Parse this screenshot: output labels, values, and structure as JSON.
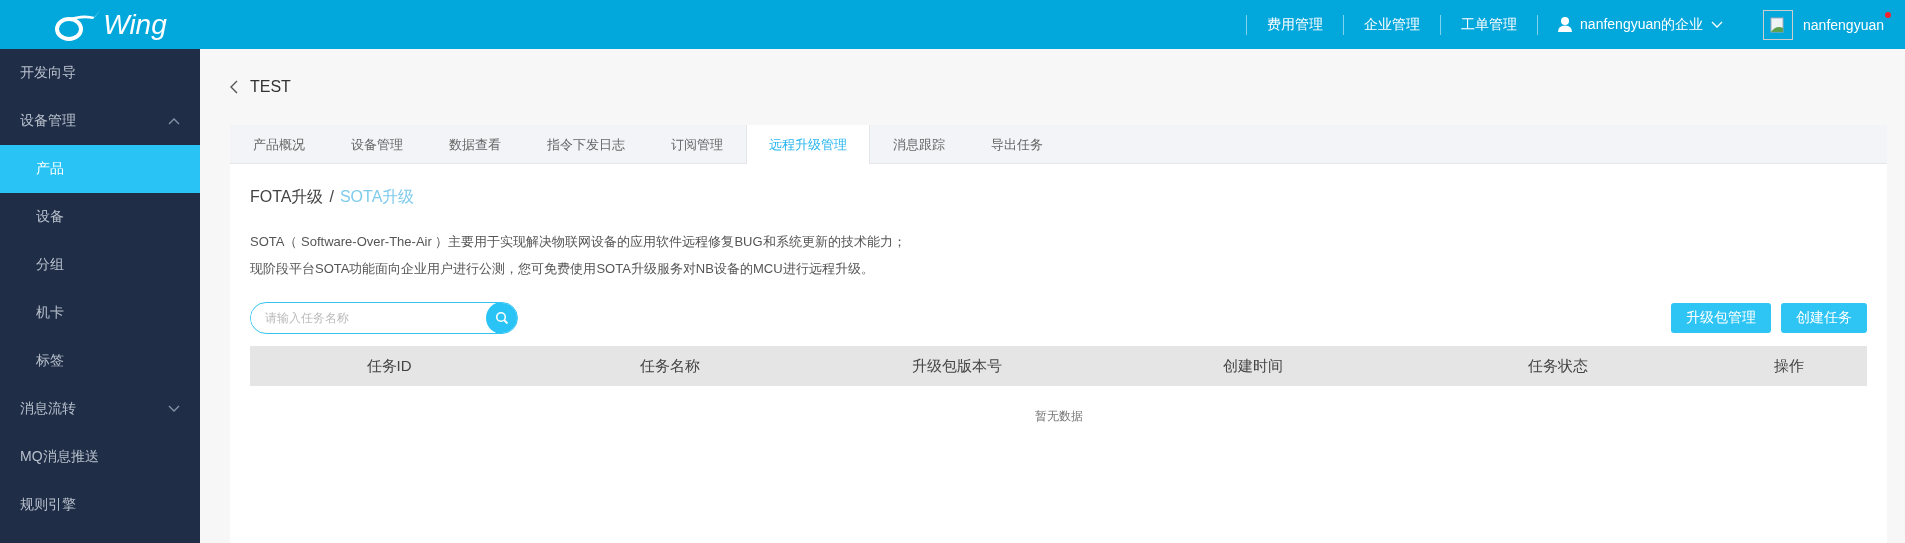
{
  "header": {
    "logo_text": "Wing",
    "nav": [
      {
        "label": "费用管理"
      },
      {
        "label": "企业管理"
      },
      {
        "label": "工单管理"
      }
    ],
    "account": {
      "label": "nanfengyuan的企业"
    },
    "user": {
      "name": "nanfengyuan",
      "notification": true
    }
  },
  "sidebar": {
    "items": [
      {
        "kind": "link",
        "label": "开发向导",
        "selected": false
      },
      {
        "kind": "group",
        "label": "设备管理",
        "selected": false,
        "expanded": true,
        "children": [
          {
            "label": "产品",
            "selected": true
          },
          {
            "label": "设备",
            "selected": false
          },
          {
            "label": "分组",
            "selected": false
          },
          {
            "label": "机卡",
            "selected": false
          },
          {
            "label": "标签",
            "selected": false
          }
        ]
      },
      {
        "kind": "group",
        "label": "消息流转",
        "selected": false,
        "expanded": false
      },
      {
        "kind": "link",
        "label": "MQ消息推送",
        "selected": false
      },
      {
        "kind": "link",
        "label": "规则引擎",
        "selected": false
      }
    ]
  },
  "page": {
    "title": "TEST",
    "tabs": [
      {
        "label": "产品概况",
        "selected": false
      },
      {
        "label": "设备管理",
        "selected": false
      },
      {
        "label": "数据查看",
        "selected": false
      },
      {
        "label": "指令下发日志",
        "selected": false
      },
      {
        "label": "订阅管理",
        "selected": false
      },
      {
        "label": "远程升级管理",
        "selected": true
      },
      {
        "label": "消息跟踪",
        "selected": false
      },
      {
        "label": "导出任务",
        "selected": false
      }
    ],
    "upgrade_types": [
      {
        "label": "FOTA升级",
        "selected": false
      },
      {
        "label": "SOTA升级",
        "selected": true
      }
    ],
    "separator": "/",
    "description": [
      "SOTA（ Software-Over-The-Air ）主要用于实现解决物联网设备的应用软件远程修复BUG和系统更新的技术能力；",
      "现阶段平台SOTA功能面向企业用户进行公测，您可免费使用SOTA升级服务对NB设备的MCU进行远程升级。"
    ],
    "search": {
      "placeholder": "请输入任务名称"
    },
    "buttons": [
      "升级包管理",
      "创建任务"
    ],
    "table": {
      "columns": [
        "任务ID",
        "任务名称",
        "升级包版本号",
        "创建时间",
        "任务状态",
        "操作"
      ],
      "empty_text": "暂无数据"
    }
  }
}
